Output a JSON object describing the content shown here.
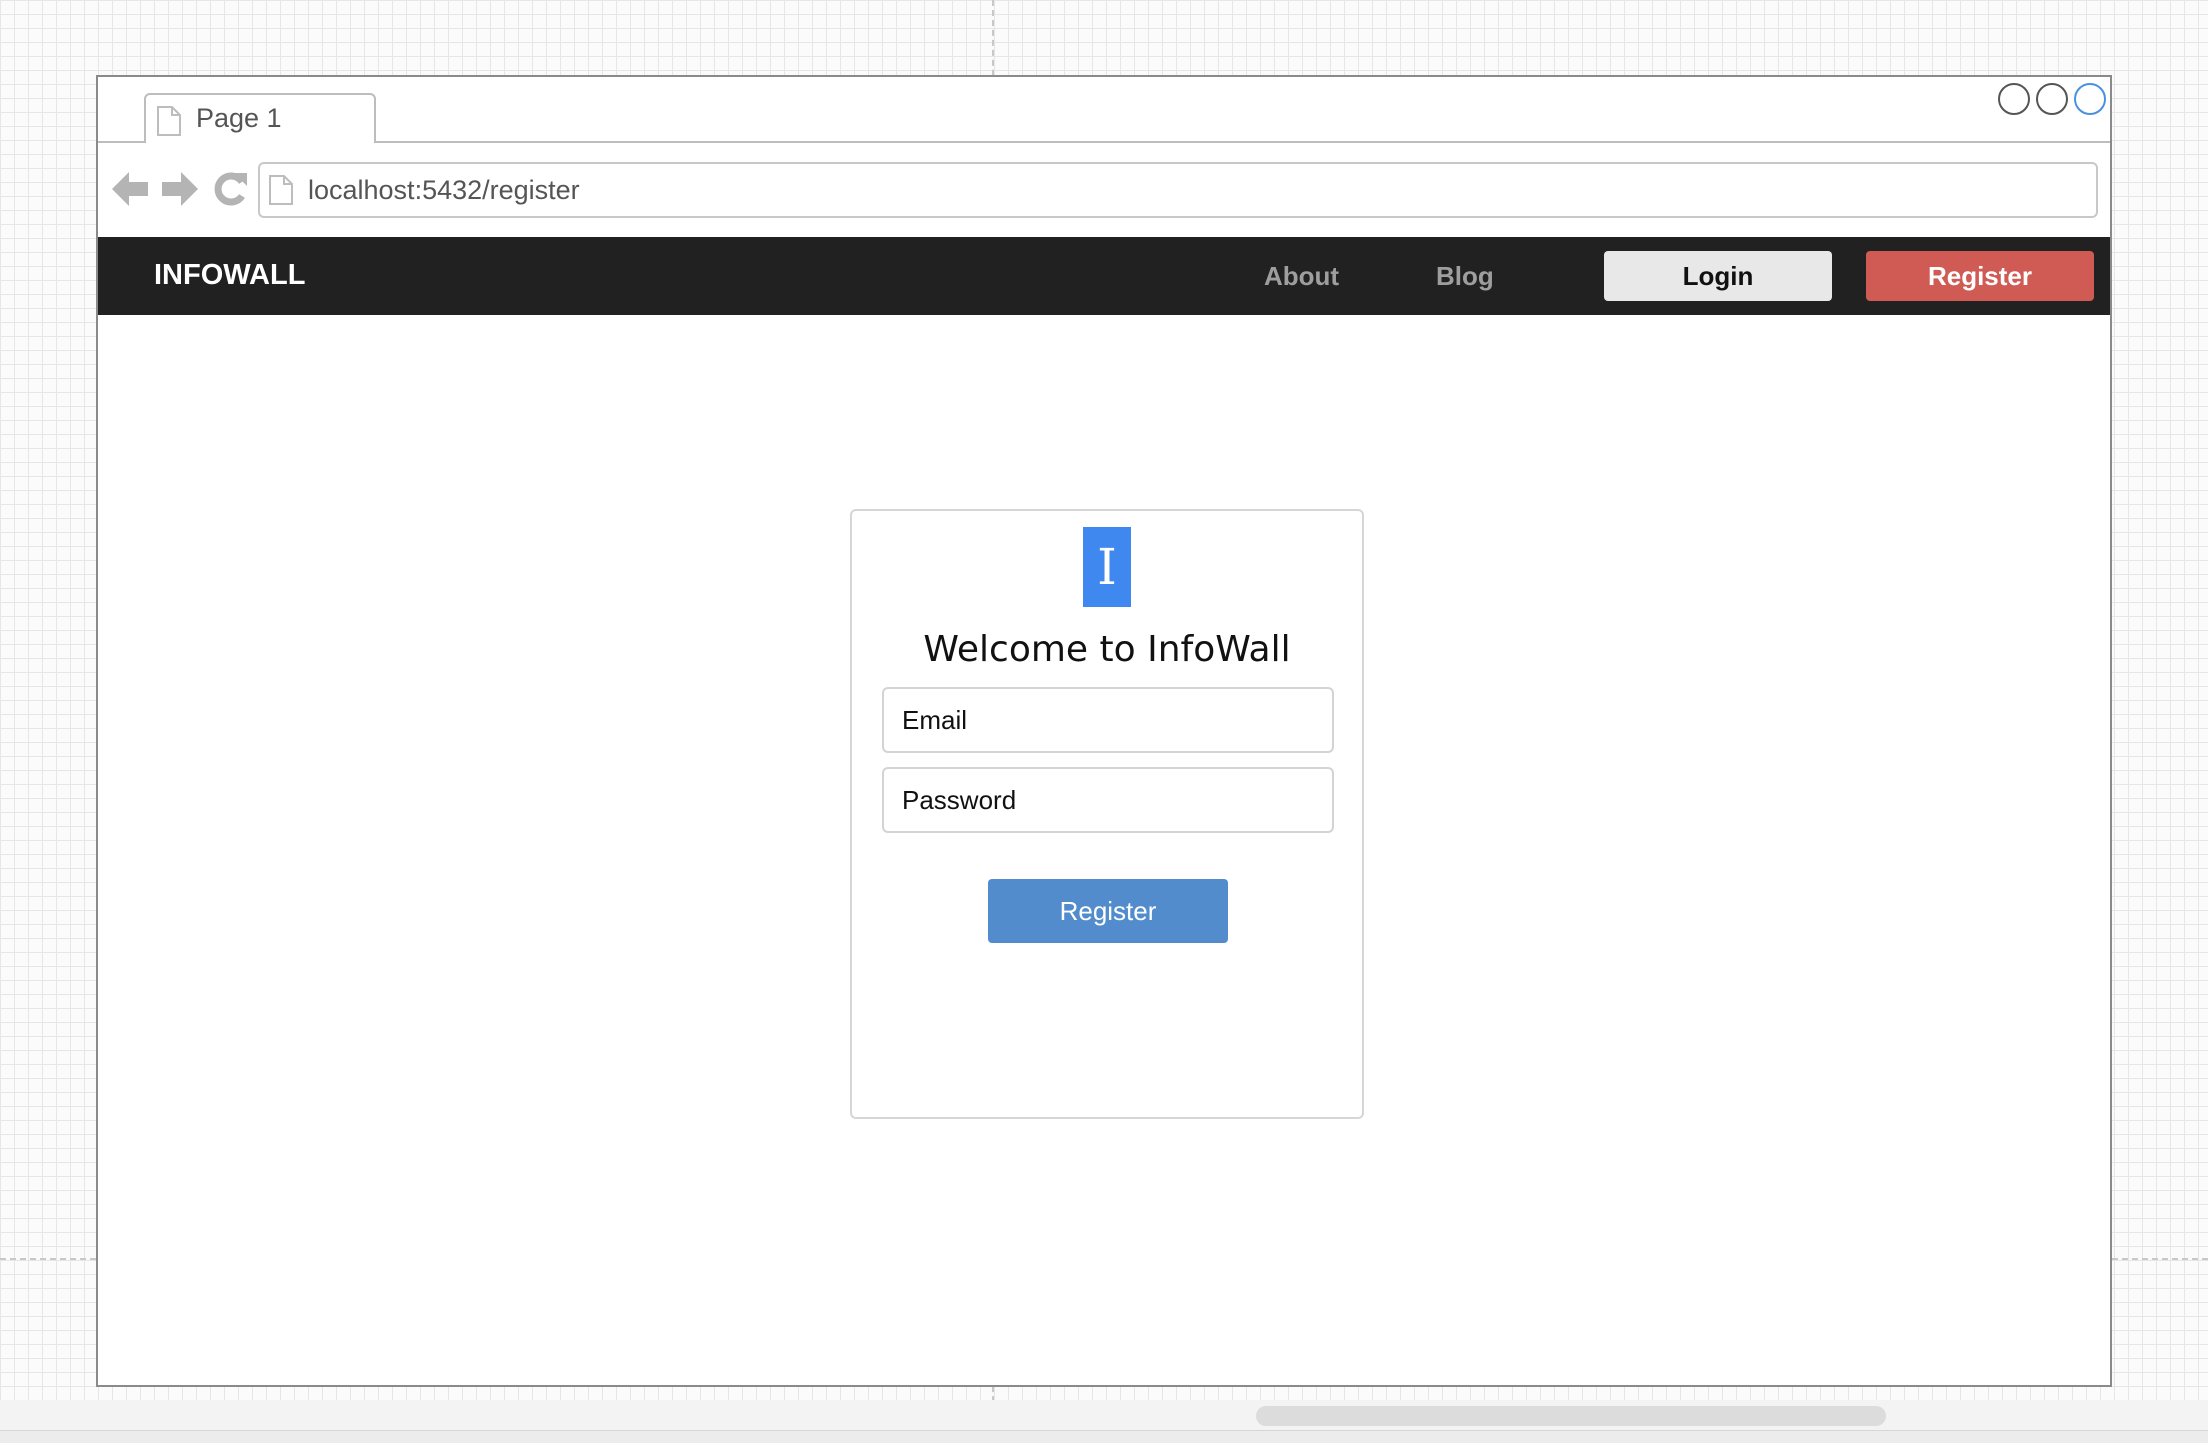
{
  "browser": {
    "tab_label": "Page 1",
    "url": "localhost:5432/register",
    "icons": [
      "file-icon",
      "back-arrow-icon",
      "forward-arrow-icon",
      "refresh-icon"
    ]
  },
  "site_nav": {
    "brand": "INFOWALL",
    "links": [
      "About",
      "Blog"
    ],
    "login_label": "Login",
    "register_label": "Register",
    "colors": {
      "bar": "#212121",
      "login": "#e8e8e8",
      "register": "#d05a54"
    }
  },
  "register_card": {
    "logo_letter": "I",
    "logo_color": "#3e88f0",
    "title": "Welcome to InfoWall",
    "email_placeholder": "Email",
    "password_placeholder": "Password",
    "submit_label": "Register",
    "submit_color": "#528ccc"
  }
}
